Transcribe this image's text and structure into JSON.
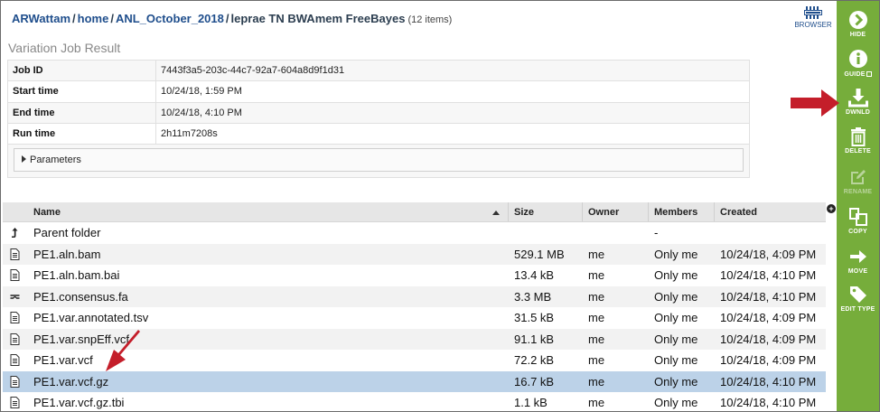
{
  "breadcrumb": {
    "parts": [
      "ARWattam",
      "home",
      "ANL_October_2018"
    ],
    "current": "leprae TN BWAmem FreeBayes",
    "item_count": "(12 items)"
  },
  "browser_button": {
    "label": "BROWSER"
  },
  "job": {
    "title": "Variation Job Result",
    "rows": [
      {
        "key": "Job ID",
        "value": "7443f3a5-203c-44c7-92a7-604a8d9f1d31"
      },
      {
        "key": "Start time",
        "value": "10/24/18, 1:59 PM"
      },
      {
        "key": "End time",
        "value": "10/24/18, 4:10 PM"
      },
      {
        "key": "Run time",
        "value": "2h11m7208s"
      }
    ],
    "parameters_label": "Parameters"
  },
  "files": {
    "columns": {
      "name": "Name",
      "size": "Size",
      "owner": "Owner",
      "members": "Members",
      "created": "Created"
    },
    "rows": [
      {
        "name": "Parent folder",
        "size": "",
        "owner": "",
        "members": "-",
        "created": "",
        "icon": "up-arrow-icon"
      },
      {
        "name": "PE1.aln.bam",
        "size": "529.1 MB",
        "owner": "me",
        "members": "Only me",
        "created": "10/24/18, 4:09 PM",
        "icon": "file-icon"
      },
      {
        "name": "PE1.aln.bam.bai",
        "size": "13.4 kB",
        "owner": "me",
        "members": "Only me",
        "created": "10/24/18, 4:10 PM",
        "icon": "file-icon"
      },
      {
        "name": "PE1.consensus.fa",
        "size": "3.3 MB",
        "owner": "me",
        "members": "Only me",
        "created": "10/24/18, 4:10 PM",
        "icon": "sequence-icon"
      },
      {
        "name": "PE1.var.annotated.tsv",
        "size": "31.5 kB",
        "owner": "me",
        "members": "Only me",
        "created": "10/24/18, 4:09 PM",
        "icon": "file-icon"
      },
      {
        "name": "PE1.var.snpEff.vcf",
        "size": "91.1 kB",
        "owner": "me",
        "members": "Only me",
        "created": "10/24/18, 4:09 PM",
        "icon": "file-icon"
      },
      {
        "name": "PE1.var.vcf",
        "size": "72.2 kB",
        "owner": "me",
        "members": "Only me",
        "created": "10/24/18, 4:09 PM",
        "icon": "file-icon"
      },
      {
        "name": "PE1.var.vcf.gz",
        "size": "16.7 kB",
        "owner": "me",
        "members": "Only me",
        "created": "10/24/18, 4:10 PM",
        "icon": "file-icon",
        "selected": true
      },
      {
        "name": "PE1.var.vcf.gz.tbi",
        "size": "1.1 kB",
        "owner": "me",
        "members": "Only me",
        "created": "10/24/18, 4:10 PM",
        "icon": "file-icon"
      }
    ]
  },
  "actions": {
    "hide": "HIDE",
    "guide": "GUIDE",
    "download": "DWNLD",
    "delete": "DELETE",
    "rename": "RENAME",
    "copy": "COPY",
    "move": "MOVE",
    "edit_type": "EDIT TYPE"
  },
  "colors": {
    "action_bar": "#76ad3b",
    "link": "#1f4e8c",
    "selected_row": "#bcd2e8",
    "annotation_arrow": "#c41e2a"
  }
}
